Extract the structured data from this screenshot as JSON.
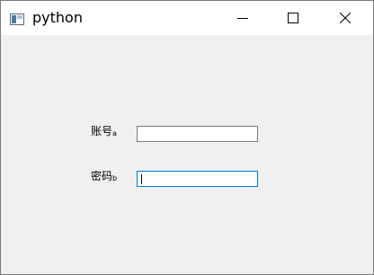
{
  "window": {
    "title": "python",
    "icon": "python-app-icon"
  },
  "titlebar_buttons": [
    {
      "name": "minimize",
      "icon": "minimize-icon"
    },
    {
      "name": "maximize",
      "icon": "maximize-icon"
    },
    {
      "name": "close",
      "icon": "close-icon"
    }
  ],
  "form": {
    "account": {
      "label": "账号",
      "sub": "a",
      "value": ""
    },
    "password": {
      "label": "密码",
      "sub": "b",
      "value": "",
      "focused": true
    }
  },
  "colors": {
    "focus_border": "#0078d7",
    "window_bg": "#f0f0f0"
  }
}
